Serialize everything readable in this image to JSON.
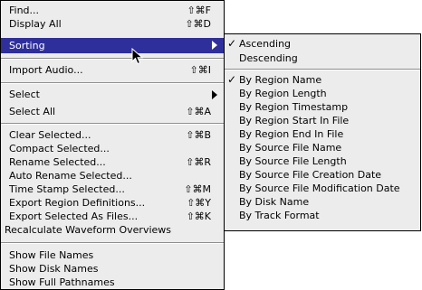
{
  "main_menu": {
    "items": [
      {
        "label": "Find...",
        "shortcut": "⇧⌘F"
      },
      {
        "label": "Display All",
        "shortcut": "⇧⌘D"
      },
      {
        "label": "Sorting",
        "shortcut": "",
        "submenu": true,
        "highlighted": true
      },
      {
        "label": "Import Audio...",
        "shortcut": "⇧⌘I"
      },
      {
        "label": "Select",
        "shortcut": "",
        "submenu": true
      },
      {
        "label": "Select All",
        "shortcut": "⇧⌘A"
      },
      {
        "label": "Clear Selected...",
        "shortcut": "⇧⌘B"
      },
      {
        "label": "Compact Selected...",
        "shortcut": ""
      },
      {
        "label": "Rename Selected...",
        "shortcut": "⇧⌘R"
      },
      {
        "label": "Auto Rename Selected...",
        "shortcut": ""
      },
      {
        "label": "Time Stamp Selected...",
        "shortcut": "⇧⌘M"
      },
      {
        "label": "Export Region Definitions...",
        "shortcut": "⇧⌘Y"
      },
      {
        "label": "Export Selected As Files...",
        "shortcut": "⇧⌘K"
      },
      {
        "label": "Recalculate Waveform Overviews",
        "shortcut": ""
      },
      {
        "label": "Show File Names",
        "shortcut": ""
      },
      {
        "label": "Show Disk Names",
        "shortcut": ""
      },
      {
        "label": "Show Full Pathnames",
        "shortcut": ""
      }
    ]
  },
  "sorting_submenu": {
    "check_mark": "✓",
    "items": [
      {
        "label": "Ascending",
        "checked": true
      },
      {
        "label": "Descending",
        "checked": false
      },
      {
        "label": "By Region Name",
        "checked": true
      },
      {
        "label": "By Region Length",
        "checked": false
      },
      {
        "label": "By Region Timestamp",
        "checked": false
      },
      {
        "label": "By Region Start In File",
        "checked": false
      },
      {
        "label": "By Region End In File",
        "checked": false
      },
      {
        "label": "By Source File Name",
        "checked": false
      },
      {
        "label": "By Source File Length",
        "checked": false
      },
      {
        "label": "By Source File Creation Date",
        "checked": false
      },
      {
        "label": "By Source File Modification Date",
        "checked": false
      },
      {
        "label": "By Disk Name",
        "checked": false
      },
      {
        "label": "By Track Format",
        "checked": false
      }
    ]
  },
  "colors": {
    "menu_background": "#ececec",
    "highlight": "#2f2f9c",
    "highlight_text": "#ffffff",
    "separator": "#8e8e8e"
  }
}
